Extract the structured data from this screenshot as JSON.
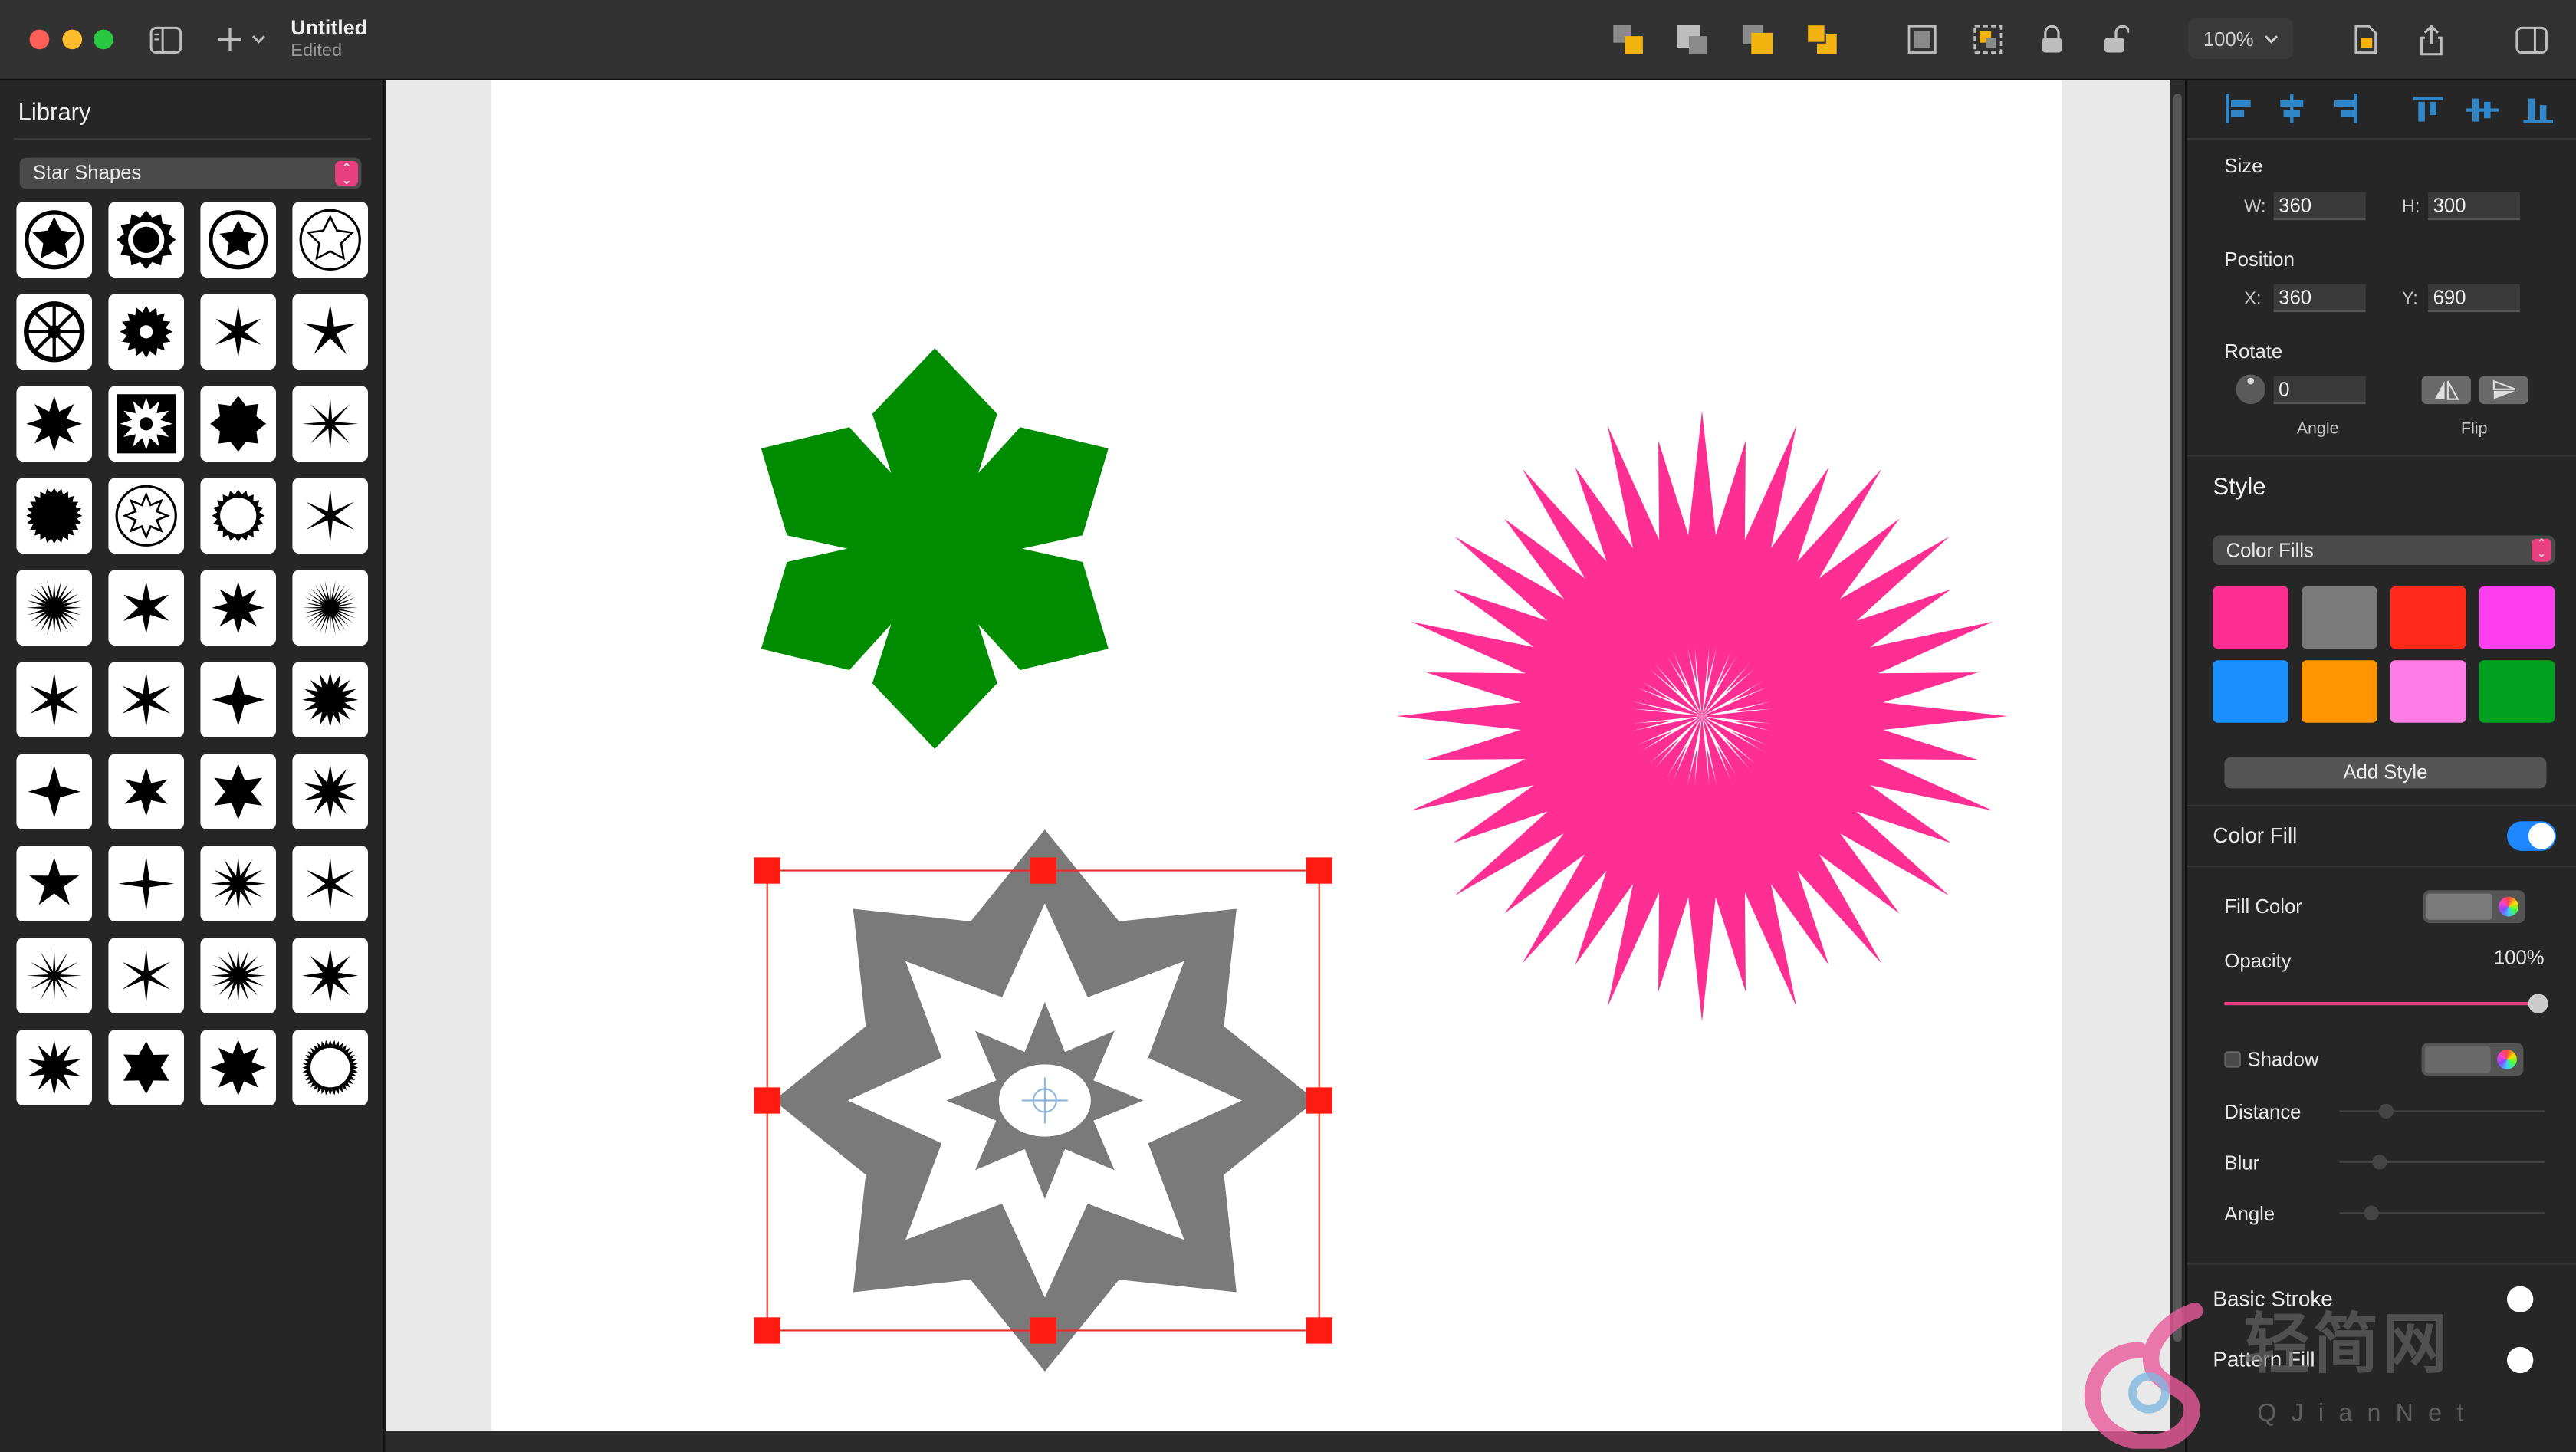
{
  "window": {
    "title": "Untitled",
    "subtitle": "Edited",
    "zoom": "100%"
  },
  "toolbar": {
    "icons": [
      "sidebar-toggle-icon",
      "add-icon",
      "chevron-down-icon",
      "bring-forward-icon",
      "send-backward-icon",
      "bring-to-front-icon",
      "send-to-back-icon",
      "group-icon",
      "ungroup-icon",
      "lock-icon",
      "unlock-icon",
      "export-icon",
      "share-icon",
      "inspector-toggle-icon"
    ]
  },
  "library": {
    "title": "Library",
    "category": "Star Shapes",
    "shape_count": 40
  },
  "inspector": {
    "size": {
      "label": "Size",
      "w_label": "W:",
      "w": "360",
      "h_label": "H:",
      "h": "300"
    },
    "position": {
      "label": "Position",
      "x_label": "X:",
      "x": "360",
      "y_label": "Y:",
      "y": "690"
    },
    "rotate": {
      "label": "Rotate",
      "angle": "0",
      "angle_label": "Angle",
      "flip_label": "Flip"
    },
    "style": {
      "label": "Style",
      "preset": "Color Fills",
      "swatches": [
        "#ff2e93",
        "#7a7a7a",
        "#ff2a1a",
        "#ff3ef0",
        "#1a90ff",
        "#ff9500",
        "#ff7ce9",
        "#00a020"
      ],
      "add_label": "Add Style"
    },
    "color_fill": {
      "label": "Color Fill",
      "enabled": true,
      "fill_color_label": "Fill Color",
      "fill_color": "#7a7a7a",
      "opacity_label": "Opacity",
      "opacity": "100%"
    },
    "shadow": {
      "label": "Shadow",
      "enabled": false,
      "distance_label": "Distance",
      "blur_label": "Blur",
      "angle_label": "Angle"
    },
    "basic_stroke": {
      "label": "Basic Stroke",
      "enabled": false
    },
    "pattern_fill": {
      "label": "Pattern Fill",
      "enabled": false
    }
  },
  "canvas": {
    "shapes": [
      {
        "name": "asterisk-star",
        "color": "#008c00"
      },
      {
        "name": "burst-star",
        "color": "#ff2e93"
      },
      {
        "name": "octagram-star",
        "color": "#7a7a7a",
        "selected": true
      }
    ]
  },
  "watermark": {
    "text": "轻简网",
    "subtext": "QJianNet"
  }
}
